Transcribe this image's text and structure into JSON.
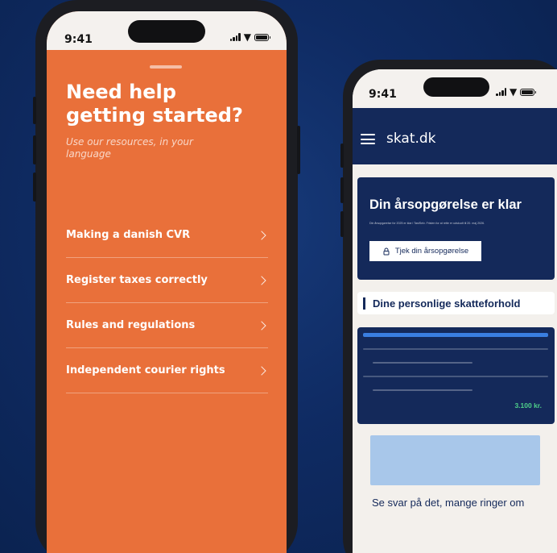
{
  "left_phone": {
    "status": {
      "time": "9:41"
    },
    "title": "Need help getting started?",
    "subtitle": "Use our resources, in your language",
    "menu": [
      {
        "label": "Making a danish CVR",
        "icon": "chevron-right-icon"
      },
      {
        "label": "Register taxes correctly",
        "icon": "chevron-right-icon"
      },
      {
        "label": "Rules and regulations",
        "icon": "chevron-right-icon"
      },
      {
        "label": "Independent courier rights",
        "icon": "chevron-right-icon"
      }
    ],
    "colors": {
      "background": "#e9703a",
      "text": "#ffffff"
    }
  },
  "right_phone": {
    "status": {
      "time": "9:41"
    },
    "header": {
      "logo": "skat.dk",
      "menu_icon": "hamburger-icon"
    },
    "hero": {
      "title": "Din årsopgørelse er klar",
      "text": "Din årsopgørelse for 2025 er klar i TastSelv. Fristen for at rette er udskudt til 20. maj 2026.",
      "button_label": "Tjek din årsopgørelse",
      "button_icon": "lock-icon"
    },
    "section": {
      "heading": "Dine personlige skatteforhold"
    },
    "summary": {
      "amount": "3.100 kr."
    },
    "faq": {
      "heading": "Se svar på det, mange ringer om"
    },
    "colors": {
      "brand": "#14295a",
      "highlight": "#3a7ee0",
      "positive": "#4fd08a",
      "image": "#a8c7ea"
    }
  }
}
